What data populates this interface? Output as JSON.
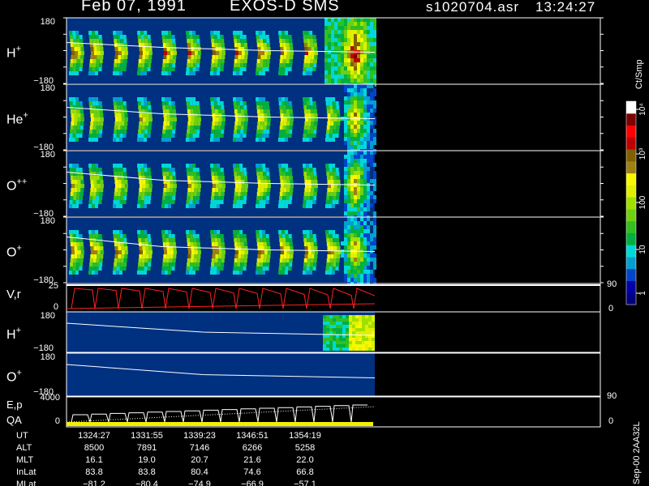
{
  "header": {
    "date": "Feb 07, 1991",
    "instrument": "EXOS-D SMS",
    "file": "s1020704.asr",
    "time": "13:24:27"
  },
  "colorbar": {
    "unit_label": "Ct/Smp",
    "tick_labels": [
      "1",
      "10",
      "100",
      "10³",
      "10⁴"
    ],
    "colors": [
      "#000080",
      "#0000a8",
      "#0044cc",
      "#00a0d0",
      "#00d8d8",
      "#00b040",
      "#30c020",
      "#70d010",
      "#a0e000",
      "#e0f000",
      "#f8f800",
      "#a08010",
      "#806000",
      "#c00000",
      "#ff0000",
      "#800000",
      "#ffffff"
    ]
  },
  "footer_note": "Sep-00 2AA32L",
  "colors": {
    "background": "#000000",
    "spectro_bg": "#003080",
    "trace": "#ffffff",
    "velocity": "#ff2020",
    "qa": "#f0f000"
  },
  "chart_data": {
    "type": "heatmap",
    "x_time_labels": [
      "1324:27",
      "1331:55",
      "1339:23",
      "1346:51",
      "1354:19"
    ],
    "panels": [
      {
        "label": "H",
        "sup": "+",
        "ymax": "180",
        "ymin": "−180"
      },
      {
        "label": "He",
        "sup": "+",
        "ymax": "180",
        "ymin": "−180"
      },
      {
        "label": "O",
        "sup": "++",
        "ymax": "180",
        "ymin": "−180"
      },
      {
        "label": "O",
        "sup": "+",
        "ymax": "180",
        "ymin": "−180"
      }
    ],
    "velocity_panel": {
      "label": "V,r",
      "left_top": "25",
      "left_bottom": "0",
      "right_top": "90",
      "right_bottom": "0"
    },
    "angle_panels": [
      {
        "label": "H",
        "sup": "+",
        "ymax": "180",
        "ymin": "−180"
      },
      {
        "label": "O",
        "sup": "+",
        "ymax": "180",
        "ymin": "−180"
      }
    ],
    "energy_panel": {
      "label1": "E,p",
      "label2": "QA",
      "left_top": "4000",
      "left_bottom": "0",
      "right_top": "90",
      "right_bottom": "0"
    },
    "ephemeris": {
      "rows": [
        {
          "name": "UT",
          "values": [
            "1324:27",
            "1331:55",
            "1339:23",
            "1346:51",
            "1354:19"
          ]
        },
        {
          "name": "ALT",
          "values": [
            "8500",
            "7891",
            "7146",
            "6266",
            "5258"
          ]
        },
        {
          "name": "MLT",
          "values": [
            "16.1",
            "19.0",
            "20.7",
            "21.6",
            "22.0"
          ]
        },
        {
          "name": "InLat",
          "values": [
            "83.8",
            "83.8",
            "80.4",
            "74.6",
            "66.8"
          ]
        },
        {
          "name": "MLat",
          "values": [
            "−81.2",
            "−80.4",
            "−74.9",
            "−66.9",
            "−57.1"
          ]
        }
      ]
    }
  }
}
